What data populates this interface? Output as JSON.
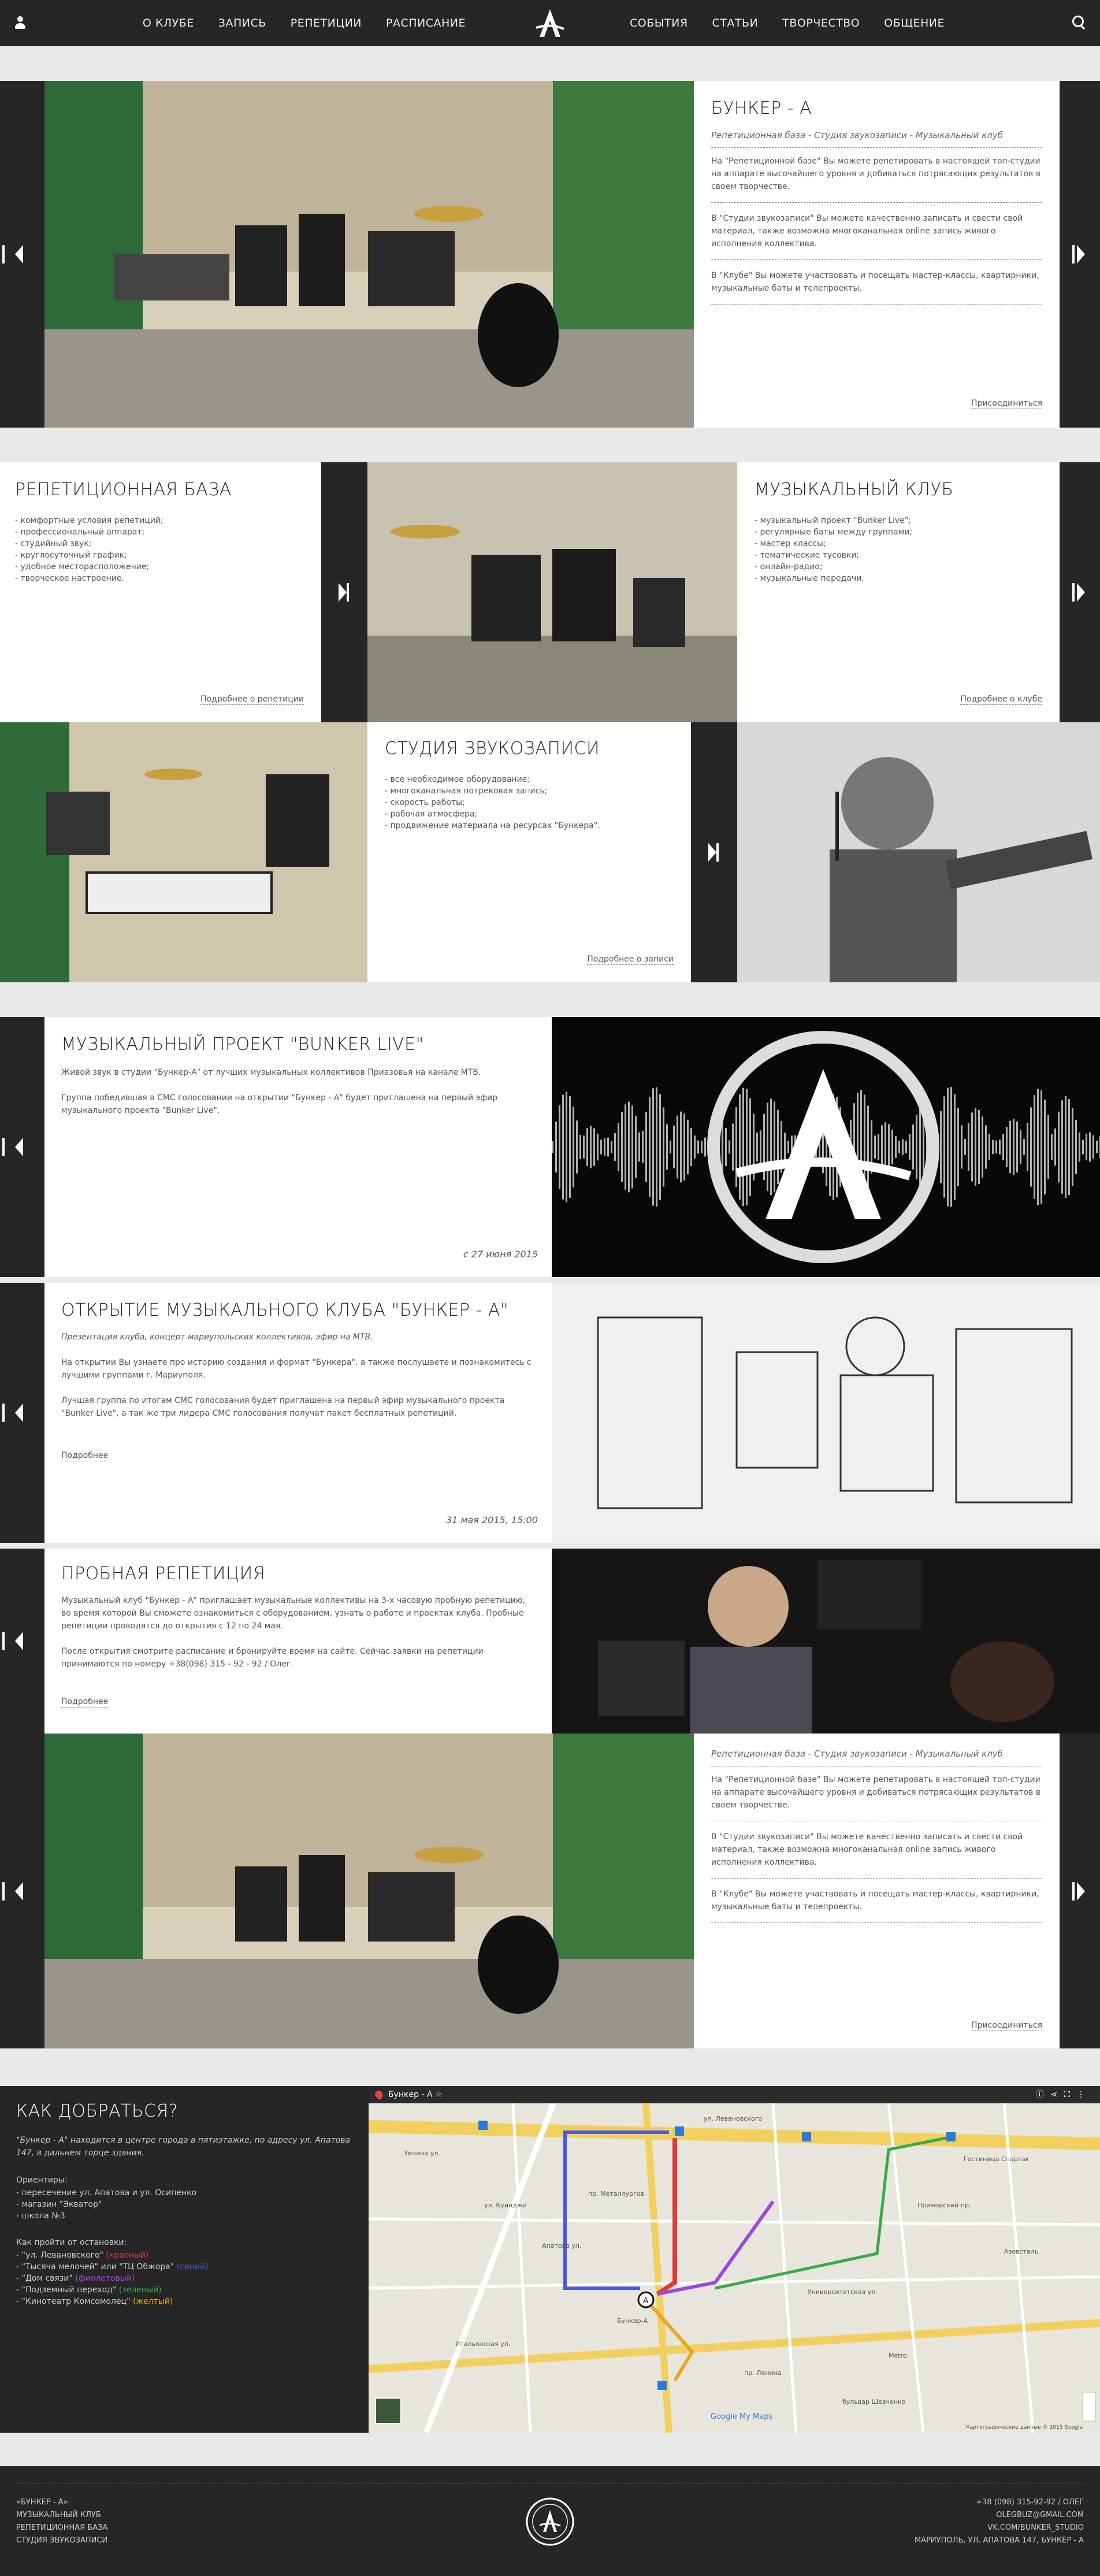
{
  "nav": {
    "left": [
      "О КЛУБЕ",
      "ЗАПИСЬ",
      "РЕПЕТИЦИИ",
      "РАСПИСАНИЕ"
    ],
    "right": [
      "СОБЫТИЯ",
      "СТАТЬИ",
      "ТВОРЧЕСТВО",
      "ОБЩЕНИЕ"
    ]
  },
  "hero": {
    "title": "БУНКЕР - А",
    "subtitle": "Репетиционная база - Студия звукозаписи - Музыкальный клуб",
    "p1": "На \"Репетиционной базе\" Вы можете репетировать в настоящей топ-студии на аппарате высочайшего уровня и добиваться потрясающих результатов в своем творчестве.",
    "p2": "В \"Студии звукозаписи\" Вы можете качественно записать и свести свой материал, также возможна многоканальная online запись живого исполнения коллектива.",
    "p3": "В \"Клубе\" Вы можете участвовать и посещать мастер-классы, квартирники, музыкальные баты и телепроекты.",
    "more": "Присоединиться"
  },
  "features": {
    "rep": {
      "title": "РЕПЕТИЦИОННАЯ БАЗА",
      "items": [
        "- комфортные условия репетиций;",
        "- профессиональный аппарат;",
        "- студийный звук;",
        "- круглосуточный график;",
        "- удобное месторасположение;",
        "- творческое настроение."
      ],
      "more": "Подробнее о репетиции"
    },
    "club": {
      "title": "МУЗЫКАЛЬНЫЙ КЛУБ",
      "items": [
        "- музыкальный проект \"Bunker Live\";",
        "- регулярные баты между группами;",
        "- мастер классы;",
        "- тематические тусовки;",
        "- онлайн-радио;",
        "- музыкальные передачи."
      ],
      "more": "Подробнее о клубе"
    },
    "studio": {
      "title": "СТУДИЯ ЗВУКОЗАПИСИ",
      "items": [
        "- все необходимое оборудование;",
        "- многоканальная потрековая запись;",
        "- скорость работы;",
        "- рабочая атмосфера;",
        "- продвижение материала на ресурсах \"Бункера\"."
      ],
      "more": "Подробнее о записи"
    }
  },
  "news": [
    {
      "title": "МУЗЫКАЛЬНЫЙ ПРОЕКТ \"BUNKER LIVE\"",
      "p1": "Живой звук в студии \"Бункер-А\" от лучших музыкальных коллективов Приазовья на канале МТВ.",
      "p2": "Группа победившая в СМС голосовании на открытии \"Бункер - А\" будет приглашена на первый эфир музыкального проекта \"Bunker Live\".",
      "date": "с 27 июня 2015"
    },
    {
      "title": "ОТКРЫТИЕ МУЗЫКАЛЬНОГО КЛУБА \"БУНКЕР - А\"",
      "p0": "Презентация клуба, концерт мариупольских коллективов, эфир на МТВ.",
      "p1": "На открытии Вы узнаете про историю создания и формат \"Бункера\", а также послушаете и познакомитесь с лучшими группами г. Мариуполя.",
      "p2": "Лучшая группа по итогам СМС голосования будет приглашена на первый эфир музыкального проекта \"Bunker Live\", а так же три лидера СМС голосования получат пакет бесплатных репетиций.",
      "more": "Подробнее",
      "date": "31 мая 2015, 15:00"
    },
    {
      "title": "ПРОБНАЯ РЕПЕТИЦИЯ",
      "p1": "Музыкальный клуб \"Бункер - А\" приглашает музыкальные коллективы на 3-х часовую пробную репетицию, во время которой Вы сможете ознакомиться с оборудованием, узнать о работе и проектах клуба. Пробные репетиции проводятся до открытия с 12 по 24 мая.",
      "p2": "После открытия смотрите расписание и бронируйте время на сайте. Сейчас заявки на репетиции принимаются по номеру +38(098) 315 - 92 - 92 / Олег.",
      "more": "Подробнее"
    }
  ],
  "hero2": {
    "subtitle": "Репетиционная база - Студия звукозаписи - Музыкальный клуб",
    "p1": "На \"Репетиционной базе\" Вы можете репетировать в настоящей топ-студии на аппарате высочайшего уровня и добиваться потрясающих результатов в своем творчестве.",
    "p2": "В \"Студии звукозаписи\" Вы можете качественно записать и свести свой материал, также возможна многоканальная online запись живого исполнения коллектива.",
    "p3": "В \"Клубе\" Вы можете участвовать и посещать мастер-классы, квартирники, музыкальные баты и телепроекты.",
    "more": "Присоединиться"
  },
  "how": {
    "title": "КАК ДОБРАТЬСЯ?",
    "intro": "\"Бункер - А\" находится в центре города в пятиэтажке, по адресу ул. Апатова 147, в дальнем торце здания.",
    "orient_h": "Ориентиры:",
    "orient": [
      "- пересечение ул. Апатова и ул. Осипенко",
      "- магазин \"Экватор\"",
      "- школа №3"
    ],
    "stops_h": "Как пройти от остановки:",
    "stops": [
      {
        "t": "- \"ул. Левановского\"",
        "c": "(красный)",
        "col": "#e03a3a"
      },
      {
        "t": "- \"Тысяча мелочей\" или \"ТЦ Обжора\"",
        "c": "(синий)",
        "col": "#4a5ad8"
      },
      {
        "t": "- \"Дом связи\"",
        "c": "(фиолетовый)",
        "col": "#9a4ad8"
      },
      {
        "t": "- \"Подземный переход\"",
        "c": "(зеленый)",
        "col": "#3aa84a"
      },
      {
        "t": "- \"Кинотеатр Комсомолец\"",
        "c": "(желтый)",
        "col": "#e8a820"
      }
    ]
  },
  "map": {
    "title": "Бункер - А",
    "google": "Google My Maps",
    "copy": "Картографические данные © 2015 Google",
    "labels": [
      "Зюзина ул.",
      "Апатова ул.",
      "Итальянская ул.",
      "Бункер-А",
      "Университетская ул.",
      "Приморский пр.",
      "Гостиница Спартак",
      "ул. Левановского",
      "Азовсталь",
      "пр. Ленина",
      "бульвар Шевченко",
      "ул. Куинджи",
      "Metro",
      "пр. Металлургов"
    ]
  },
  "footer": {
    "left": [
      "«БУНКЕР - А»",
      "МУЗЫКАЛЬНЫЙ КЛУБ",
      "РЕПЕТИЦИОННАЯ БАЗА",
      "СТУДИЯ ЗВУКОЗАПИСИ"
    ],
    "right": [
      "+38 (098) 315-92-92 / ОЛЕГ",
      "OLEGBUZ@GMAIL.COM",
      "VK.COM/BUNKER_STUDIO",
      "МАРИУПОЛЬ, УЛ. АПАТОВА 147, БУНКЕР - А"
    ]
  }
}
